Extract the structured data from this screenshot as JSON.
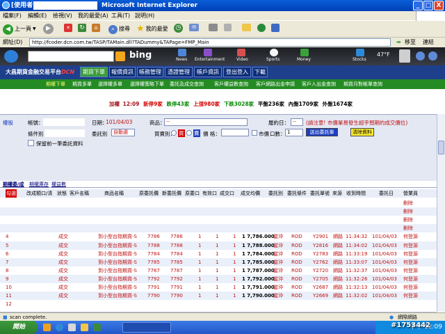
{
  "window": {
    "title_prefix": "[使用者 -",
    "title": "Microsoft Internet Explorer",
    "btn_min": "_",
    "btn_max": "□",
    "btn_close": "X"
  },
  "menu": [
    "檔案(F)",
    "編輯(E)",
    "檢視(V)",
    "我的最愛(A)",
    "工具(T)",
    "說明(H)"
  ],
  "toolbar": {
    "back": "上一頁",
    "search": "搜尋",
    "favorites": "我的最愛"
  },
  "address": {
    "label": "網址(D)",
    "url": "http://fcoder.dcn.com.tw/TASP/TAMain.dll?TADummy&TAPage=FMP_Main",
    "go": "移至",
    "links": "連結"
  },
  "bing": {
    "logo": "bing",
    "categories": [
      "News",
      "Entertainment",
      "Video",
      "Sports",
      "Money",
      "Stocks"
    ],
    "weather": "47°F"
  },
  "app": {
    "title": "大昌期貨金融交易平台",
    "title_suffix": "DCN",
    "nav": [
      "期貨下單",
      "報價資訊",
      "帳務管理",
      "憑證管理",
      "帳戶資訊",
      "登出登入",
      "下載"
    ],
    "subnav": [
      "期權下單",
      "期貨多單",
      "選擇權多單",
      "選擇權策略下單",
      "委託及成交查詢",
      "客戶權益數查詢",
      "客戶網路出金申請",
      "客戶入出金查詢",
      "期貨月對帳單查詢"
    ]
  },
  "summary": {
    "label": "加權",
    "time": "12:09",
    "new": "新停9家",
    "up": "上漲980家",
    "limit_up": "跌停43家",
    "limit_up_color": "#0a8a0a",
    "down": "下跌3028家",
    "flat": "平盤236家",
    "inner": "內盤1709家",
    "outer": "外盤1674家"
  },
  "form": {
    "section": "權股",
    "account_label": "帳號：",
    "cond_label": "條件別",
    "date_label": "日期：",
    "date_value": "101/04/03",
    "product_label": "商品：",
    "product_value": "--",
    "expiry_label": "履約日：",
    "expiry_value": "--",
    "order_type_label": "委託別",
    "order_type_value": "自動選",
    "buysell_label": "買賣別：",
    "buy": "買",
    "sell": "賣",
    "price_label": "價 格：",
    "market_label": "市價",
    "qty_label": "口數：",
    "qty_value": "1",
    "keep_label": "保留前一筆委託資料",
    "notice": "(請注意! 市價單易發生超乎預期的成交價位)",
    "submit": "送出委託單",
    "clear": "清除資料"
  },
  "tabs": [
    "期權委/成",
    "期權庫存",
    "權益數"
  ],
  "grid": {
    "headers": [
      "勾選",
      "改成類口/清",
      "狀態",
      "客戶名稱",
      "商品名稱",
      "原委託價",
      "新委託價",
      "原委口",
      "有效口",
      "成交口",
      "成交均價",
      "委託別",
      "委託條件",
      "委託單號",
      "來源",
      "收到時間",
      "委託日",
      "營業員"
    ],
    "rows": [
      {
        "idx": "",
        "status": "",
        "name": "",
        "product": "",
        "orig_price": "",
        "new_price": "",
        "orig_qty": "",
        "valid_qty": "",
        "done_qty": "",
        "avg": "",
        "type": "",
        "cond": "",
        "no": "",
        "src": "",
        "time": "",
        "date": "",
        "sales": "刪除"
      },
      {
        "idx": "",
        "status": "",
        "name": "",
        "product": "",
        "orig_price": "",
        "new_price": "",
        "orig_qty": "",
        "valid_qty": "",
        "done_qty": "",
        "avg": "",
        "type": "",
        "cond": "",
        "no": "",
        "src": "",
        "time": "",
        "date": "",
        "sales": "刪除"
      },
      {
        "idx": "",
        "status": "",
        "name": "",
        "product": "",
        "orig_price": "",
        "new_price": "",
        "orig_qty": "",
        "valid_qty": "",
        "done_qty": "",
        "avg": "",
        "type": "",
        "cond": "",
        "no": "",
        "src": "",
        "time": "",
        "date": "",
        "sales": "刪除"
      },
      {
        "idx": "",
        "status": "",
        "name": "",
        "product": "",
        "orig_price": "",
        "new_price": "",
        "orig_qty": "",
        "valid_qty": "",
        "done_qty": "",
        "avg": "",
        "type": "",
        "cond": "",
        "no": "",
        "src": "",
        "time": "",
        "date": "",
        "sales": "刪除"
      },
      {
        "idx": "4",
        "status": "成交",
        "name": "",
        "product": "到小型台指期貨-S",
        "orig_price": "7786",
        "new_price": "7786",
        "orig_qty": "1",
        "valid_qty": "1",
        "done_qty": "1",
        "avg": "1 7,786.000",
        "type": "當沖",
        "cond": "ROD",
        "no": "Y2901",
        "src": "網路",
        "time": "11:34:32",
        "date": "101/04/03",
        "sales": "何登源"
      },
      {
        "idx": "5",
        "status": "成交",
        "name": "",
        "product": "到小型台指期貨-S",
        "orig_price": "7788",
        "new_price": "7788",
        "orig_qty": "1",
        "valid_qty": "1",
        "done_qty": "1",
        "avg": "1 7,788.000",
        "type": "當沖",
        "cond": "ROD",
        "no": "Y2816",
        "src": "網路",
        "time": "11:34:02",
        "date": "101/04/03",
        "sales": "何登源"
      },
      {
        "idx": "6",
        "status": "成交",
        "name": "",
        "product": "到小型台指期貨-S",
        "orig_price": "7784",
        "new_price": "7784",
        "orig_qty": "1",
        "valid_qty": "1",
        "done_qty": "1",
        "avg": "1 7,784.000",
        "type": "當沖",
        "cond": "ROD",
        "no": "Y2783",
        "src": "網路",
        "time": "11:33:19",
        "date": "101/04/03",
        "sales": "何登源"
      },
      {
        "idx": "7",
        "status": "成交",
        "name": "",
        "product": "到小型台指期貨-S",
        "orig_price": "7785",
        "new_price": "7785",
        "orig_qty": "1",
        "valid_qty": "1",
        "done_qty": "1",
        "avg": "1 7,785.000",
        "type": "當沖",
        "cond": "ROD",
        "no": "Y2762",
        "src": "網路",
        "time": "11:33:07",
        "date": "101/04/03",
        "sales": "何登源"
      },
      {
        "idx": "8",
        "status": "成交",
        "name": "",
        "product": "到小型台指期貨-S",
        "orig_price": "7787",
        "new_price": "7787",
        "orig_qty": "1",
        "valid_qty": "1",
        "done_qty": "1",
        "avg": "1 7,787.000",
        "type": "當沖",
        "cond": "ROD",
        "no": "Y2720",
        "src": "網路",
        "time": "11:32:37",
        "date": "101/04/03",
        "sales": "何登源"
      },
      {
        "idx": "9",
        "status": "成交",
        "name": "",
        "product": "到小型台指期貨-S",
        "orig_price": "7792",
        "new_price": "7792",
        "orig_qty": "1",
        "valid_qty": "1",
        "done_qty": "1",
        "avg": "1 7,792.000",
        "type": "當沖",
        "cond": "ROD",
        "no": "Y2705",
        "src": "網路",
        "time": "11:32:26",
        "date": "101/04/03",
        "sales": "何登源"
      },
      {
        "idx": "10",
        "status": "成交",
        "name": "",
        "product": "到小型台指期貨-S",
        "orig_price": "7791",
        "new_price": "7791",
        "orig_qty": "1",
        "valid_qty": "1",
        "done_qty": "1",
        "avg": "1 7,791.000",
        "type": "當沖",
        "cond": "ROD",
        "no": "Y2687",
        "src": "網路",
        "time": "11:32:13",
        "date": "101/04/03",
        "sales": "何登源"
      },
      {
        "idx": "11",
        "status": "成交",
        "name": "",
        "product": "到小型台指期貨-S",
        "orig_price": "7790",
        "new_price": "7790",
        "orig_qty": "1",
        "valid_qty": "1",
        "done_qty": "1",
        "avg": "1 7,790.000",
        "type": "當沖",
        "cond": "ROD",
        "no": "Y2669",
        "src": "網路",
        "time": "11:32:02",
        "date": "101/04/03",
        "sales": "何登源"
      },
      {
        "idx": "12",
        "status": "",
        "name": "",
        "product": "",
        "orig_price": "",
        "new_price": "",
        "orig_qty": "",
        "valid_qty": "",
        "done_qty": "",
        "avg": "",
        "type": "",
        "cond": "",
        "no": "",
        "src": "",
        "time": "",
        "date": "",
        "sales": ""
      }
    ]
  },
  "status": {
    "text": "scan complete.",
    "zone": "網際網路"
  },
  "taskbar": {
    "start": "開始",
    "clock": "下午 12:09"
  },
  "watermark": "#1753442"
}
